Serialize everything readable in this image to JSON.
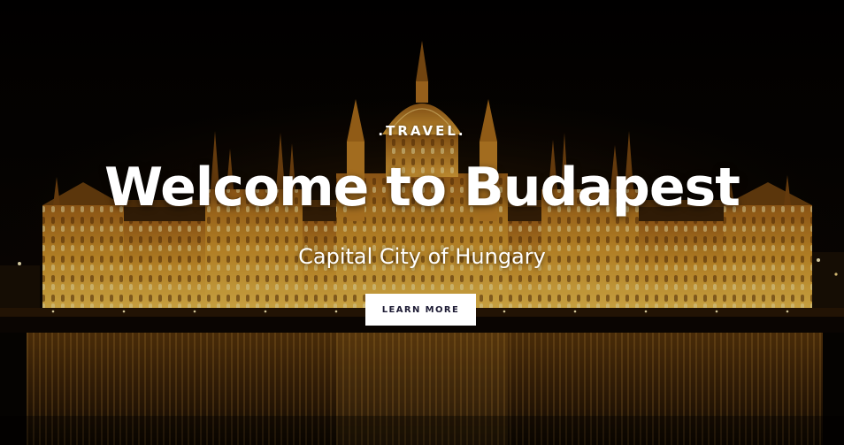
{
  "hero": {
    "eyebrow": ".TRAVEL.",
    "headline": "Welcome to Budapest",
    "subtitle": "Capital City of Hungary",
    "cta_label": "LEARN MORE"
  },
  "colors": {
    "background": "#050302",
    "text": "#ffffff",
    "button_bg": "#ffffff",
    "button_text": "#1c1a33",
    "illumination": "#e0a22a"
  }
}
